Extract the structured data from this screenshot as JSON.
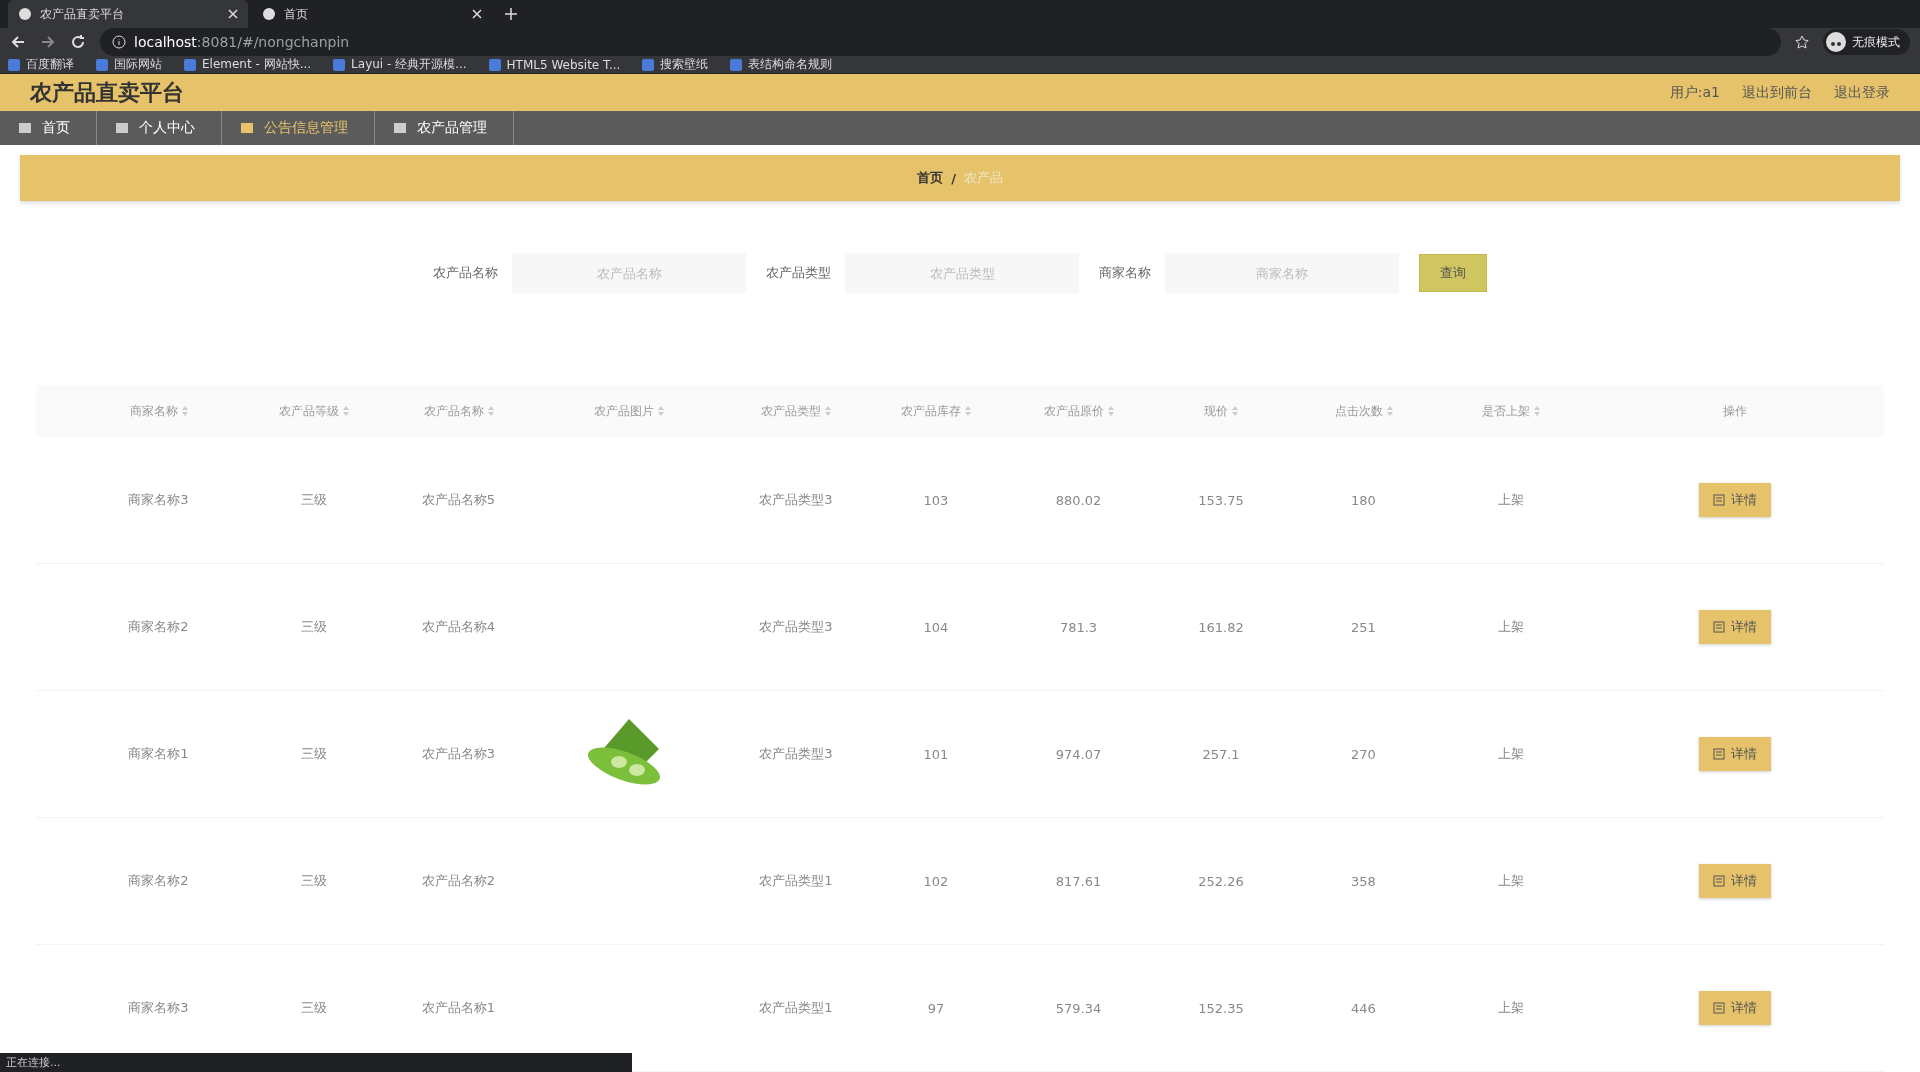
{
  "browser": {
    "tabs": [
      {
        "title": "农产品直卖平台",
        "selected": true
      },
      {
        "title": "首页",
        "selected": false
      }
    ],
    "url_host": "localhost",
    "url_path": ":8081/#/nongchanpin",
    "bookmarks": [
      "百度翻译",
      "国际网站",
      "Element - 网站快...",
      "Layui - 经典开源模...",
      "HTML5 Website T...",
      "搜索壁纸",
      "表结构命名规则"
    ],
    "profile": "无痕模式"
  },
  "header": {
    "title": "农产品直卖平台",
    "links": [
      "用户:a1",
      "退出到前台",
      "退出登录"
    ]
  },
  "nav": [
    {
      "label": "首页",
      "selected": false
    },
    {
      "label": "个人中心",
      "selected": false
    },
    {
      "label": "公告信息管理",
      "selected": true
    },
    {
      "label": "农产品管理",
      "selected": false
    }
  ],
  "breadcrumb": {
    "items": [
      "首页",
      "农产品"
    ],
    "separator": "/"
  },
  "search": {
    "fields": [
      {
        "label": "农产品名称",
        "placeholder": "农产品名称"
      },
      {
        "label": "农产品类型",
        "placeholder": "农产品类型"
      },
      {
        "label": "商家名称",
        "placeholder": "商家名称"
      }
    ],
    "button": "查询"
  },
  "table": {
    "columns": [
      "商家名称",
      "农产品等级",
      "农产品名称",
      "农产品图片",
      "农产品类型",
      "农产品库存",
      "农产品原价",
      "现价",
      "点击次数",
      "是否上架",
      "操作"
    ],
    "rows": [
      {
        "cells": [
          "商家名称3",
          "三级",
          "农产品名称5",
          "",
          "农产品类型3",
          "103",
          "880.02",
          "153.75",
          "180",
          "上架"
        ],
        "photo": false,
        "action": "详情"
      },
      {
        "cells": [
          "商家名称2",
          "三级",
          "农产品名称4",
          "",
          "农产品类型3",
          "104",
          "781.3",
          "161.82",
          "251",
          "上架"
        ],
        "photo": false,
        "action": "详情"
      },
      {
        "cells": [
          "商家名称1",
          "三级",
          "农产品名称3",
          "",
          "农产品类型3",
          "101",
          "974.07",
          "257.1",
          "270",
          "上架"
        ],
        "photo": true,
        "action": "详情"
      },
      {
        "cells": [
          "商家名称2",
          "三级",
          "农产品名称2",
          "",
          "农产品类型1",
          "102",
          "817.61",
          "252.26",
          "358",
          "上架"
        ],
        "photo": false,
        "action": "详情"
      },
      {
        "cells": [
          "商家名称3",
          "三级",
          "农产品名称1",
          "",
          "农产品类型1",
          "97",
          "579.34",
          "152.35",
          "446",
          "上架"
        ],
        "photo": false,
        "action": "详情"
      }
    ]
  },
  "status_bar": "正在连接..."
}
